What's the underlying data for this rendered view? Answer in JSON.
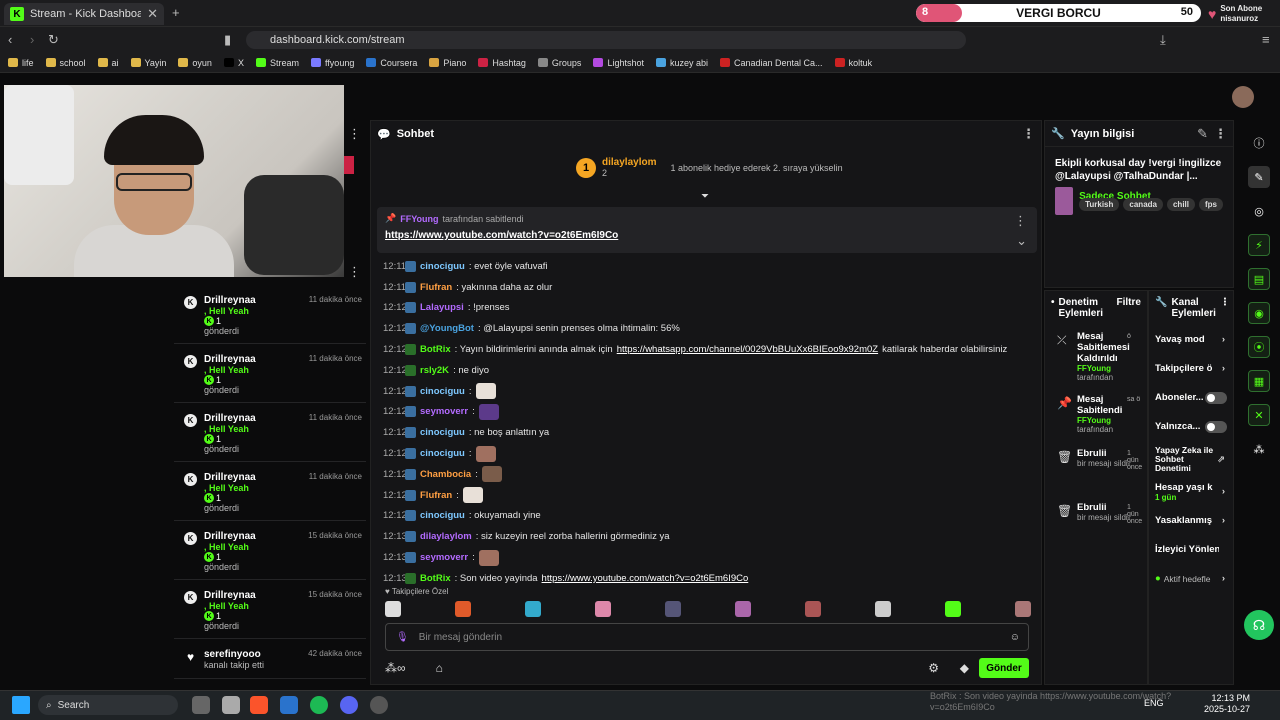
{
  "browser": {
    "tab_title": "Stream - Kick Dashboard",
    "url": "dashboard.kick.com/stream",
    "bookmarks": [
      {
        "label": "life",
        "color": "#e0b84a"
      },
      {
        "label": "school",
        "color": "#e0b84a"
      },
      {
        "label": "ai",
        "color": "#e0b84a"
      },
      {
        "label": "Yayin",
        "color": "#e0b84a"
      },
      {
        "label": "oyun",
        "color": "#e0b84a"
      },
      {
        "label": "X",
        "color": "#000000"
      },
      {
        "label": "Stream",
        "color": "#53fc18"
      },
      {
        "label": "ffyoung",
        "color": "#7a7aff"
      },
      {
        "label": "Coursera",
        "color": "#2a73cc"
      },
      {
        "label": "Piano",
        "color": "#d9a441"
      },
      {
        "label": "Hashtag",
        "color": "#cc2244"
      },
      {
        "label": "Groups",
        "color": "#888888"
      },
      {
        "label": "Lightshot",
        "color": "#b34ae0"
      },
      {
        "label": "kuzey abi",
        "color": "#4aa3e0"
      },
      {
        "label": "Canadian Dental Ca...",
        "color": "#cc2222"
      },
      {
        "label": "koltuk",
        "color": "#cc2222"
      }
    ]
  },
  "overlay": {
    "goal_current": "8",
    "goal_label": "VERGI BORCU",
    "goal_target": "50",
    "goal_progress": 0.16,
    "last_sub_title": "Son Abone",
    "last_sub_name": "nisanuroz"
  },
  "activity": [
    {
      "name": "Drillreynaa",
      "sub": ", Hell Yeah",
      "count": "1",
      "action": "gönderdi",
      "time": "11 dakika önce"
    },
    {
      "name": "Drillreynaa",
      "sub": ", Hell Yeah",
      "count": "1",
      "action": "gönderdi",
      "time": "11 dakika önce"
    },
    {
      "name": "Drillreynaa",
      "sub": ", Hell Yeah",
      "count": "1",
      "action": "gönderdi",
      "time": "11 dakika önce"
    },
    {
      "name": "Drillreynaa",
      "sub": ", Hell Yeah",
      "count": "1",
      "action": "gönderdi",
      "time": "11 dakika önce"
    },
    {
      "name": "Drillreynaa",
      "sub": ", Hell Yeah",
      "count": "1",
      "action": "gönderdi",
      "time": "15 dakika önce"
    },
    {
      "name": "Drillreynaa",
      "sub": ", Hell Yeah",
      "count": "1",
      "action": "gönderdi",
      "time": "15 dakika önce"
    }
  ],
  "activity_follow": {
    "name": "serefinyooo",
    "action": "kanalı takip etti",
    "time": "42 dakika önce"
  },
  "chat": {
    "title": "Sohbet",
    "top_user": "dilaylaylom",
    "top_user_count": "2",
    "top_info": "1 abonelik hediye ederek 2. sıraya yükselin",
    "pinned_by_user": "FFYoung",
    "pinned_by_text": "tarafından sabitlendi",
    "pinned_link": "https://www.youtube.com/watch?v=o2t6Em6I9Co",
    "messages": [
      {
        "time": "12:11",
        "user": "cinociguu",
        "color": "#7ec8ff",
        "text": ": evet öyle vafuvafi"
      },
      {
        "time": "12:11",
        "user": "Flufran",
        "color": "#ff9f43",
        "text": ": yakınına daha az olur"
      },
      {
        "time": "12:12",
        "user": "Lalayupsi",
        "color": "#b36bff",
        "text": ": !prenses"
      },
      {
        "time": "12:12",
        "user": "@YoungBot",
        "color": "#4aa3e0",
        "text": ": @Lalayupsi senin prenses olma ihtimalin: 56%"
      },
      {
        "time": "12:12",
        "user": "BotRix",
        "color": "#53fc18",
        "text": ": Yayın bildirimlerini anında almak için ",
        "link": "https://whatsapp.com/channel/0029VbBUuXx6BIEoo9x92m0Z",
        "after": " katilarak haberdar olabilirsiniz"
      },
      {
        "time": "12:12",
        "user": "rsly2K",
        "color": "#53fc18",
        "text": ": ne diyo"
      },
      {
        "time": "12:12",
        "user": "cinociguu",
        "color": "#7ec8ff",
        "text": ":"
      },
      {
        "time": "12:12",
        "user": "seymoverr",
        "color": "#b36bff",
        "text": ":"
      },
      {
        "time": "12:12",
        "user": "cinociguu",
        "color": "#7ec8ff",
        "text": ": ne boş anlattın ya"
      },
      {
        "time": "12:12",
        "user": "cinociguu",
        "color": "#7ec8ff",
        "text": ":"
      },
      {
        "time": "12:12",
        "user": "Chambocia",
        "color": "#ff9f43",
        "text": ":"
      },
      {
        "time": "12:12",
        "user": "Flufran",
        "color": "#ff9f43",
        "text": ":"
      },
      {
        "time": "12:12",
        "user": "cinociguu",
        "color": "#7ec8ff",
        "text": ": okuyamadı yine"
      },
      {
        "time": "12:13",
        "user": "dilaylaylom",
        "color": "#b36bff",
        "text": ": siz kuzeyin reel zorba hallerini görmediniz ya"
      },
      {
        "time": "12:13",
        "user": "seymoverr",
        "color": "#b36bff",
        "text": ":"
      },
      {
        "time": "12:13",
        "user": "BotRix",
        "color": "#53fc18",
        "text": ": Son video yayinda ",
        "link": "https://www.youtube.com/watch?v=o2t6Em6I9Co"
      }
    ],
    "followers_label": "Takipçilere Özel",
    "input_placeholder": "Bir mesaj gönderin",
    "send_label": "Gönder"
  },
  "stream_info": {
    "title": "Yayın bilgisi",
    "stream_title": "Ekipli korkusal day !vergi !ingilizce @Lalayupsi @TalhaDundar |...",
    "category": "Sadece Sohbet",
    "tags": [
      "Turkish",
      "canada",
      "chill",
      "fps"
    ]
  },
  "mod_log": {
    "title": "Denetim Eylemleri",
    "filter": "Filtre",
    "items": [
      {
        "icon": "unpin-icon",
        "name": "Mesaj Sabitlemesi Kaldırıldı",
        "by": "FFYoung",
        "by_suffix": "tarafından",
        "when": "ö"
      },
      {
        "icon": "pin-icon",
        "name": "Mesaj Sabitlendi",
        "by": "FFYoung",
        "by_suffix": "tarafından",
        "when": "sa ö"
      },
      {
        "icon": "trash-icon",
        "name": "Ebrulii",
        "by": "",
        "by_suffix": "bir mesajı sildi",
        "when": "1 gün önce"
      },
      {
        "icon": "trash-icon",
        "name": "Ebrulii",
        "by": "",
        "by_suffix": "bir mesajı sildi",
        "when": "1 gün önce"
      }
    ]
  },
  "channel_actions": {
    "title": "Kanal Eylemleri",
    "items": [
      {
        "label": "Yavaş mod",
        "type": "arrow"
      },
      {
        "label": "Takipçilere ö",
        "type": "arrow"
      },
      {
        "label": "Aboneler...",
        "type": "toggle"
      },
      {
        "label": "Yalnızca...",
        "type": "toggle"
      },
      {
        "label": "Yapay Zeka ile Sohbet Denetimi",
        "type": "link"
      },
      {
        "label": "Hesap yaşı k",
        "type": "arrow",
        "sub": "1 gün"
      },
      {
        "label": "Yasaklanmış",
        "type": "arrow"
      },
      {
        "label": "İzleyici Yönlendir",
        "type": "none"
      },
      {
        "label": "Aktif hedefle",
        "type": "arrow"
      }
    ]
  },
  "taskbar": {
    "search_label": "Search",
    "lang": "ENG",
    "time": "12:13 PM",
    "date": "2025-10-27",
    "notif": "BotRix : Son video yayinda https://www.youtube.com/watch?v=o2t6Em6I9Co"
  }
}
